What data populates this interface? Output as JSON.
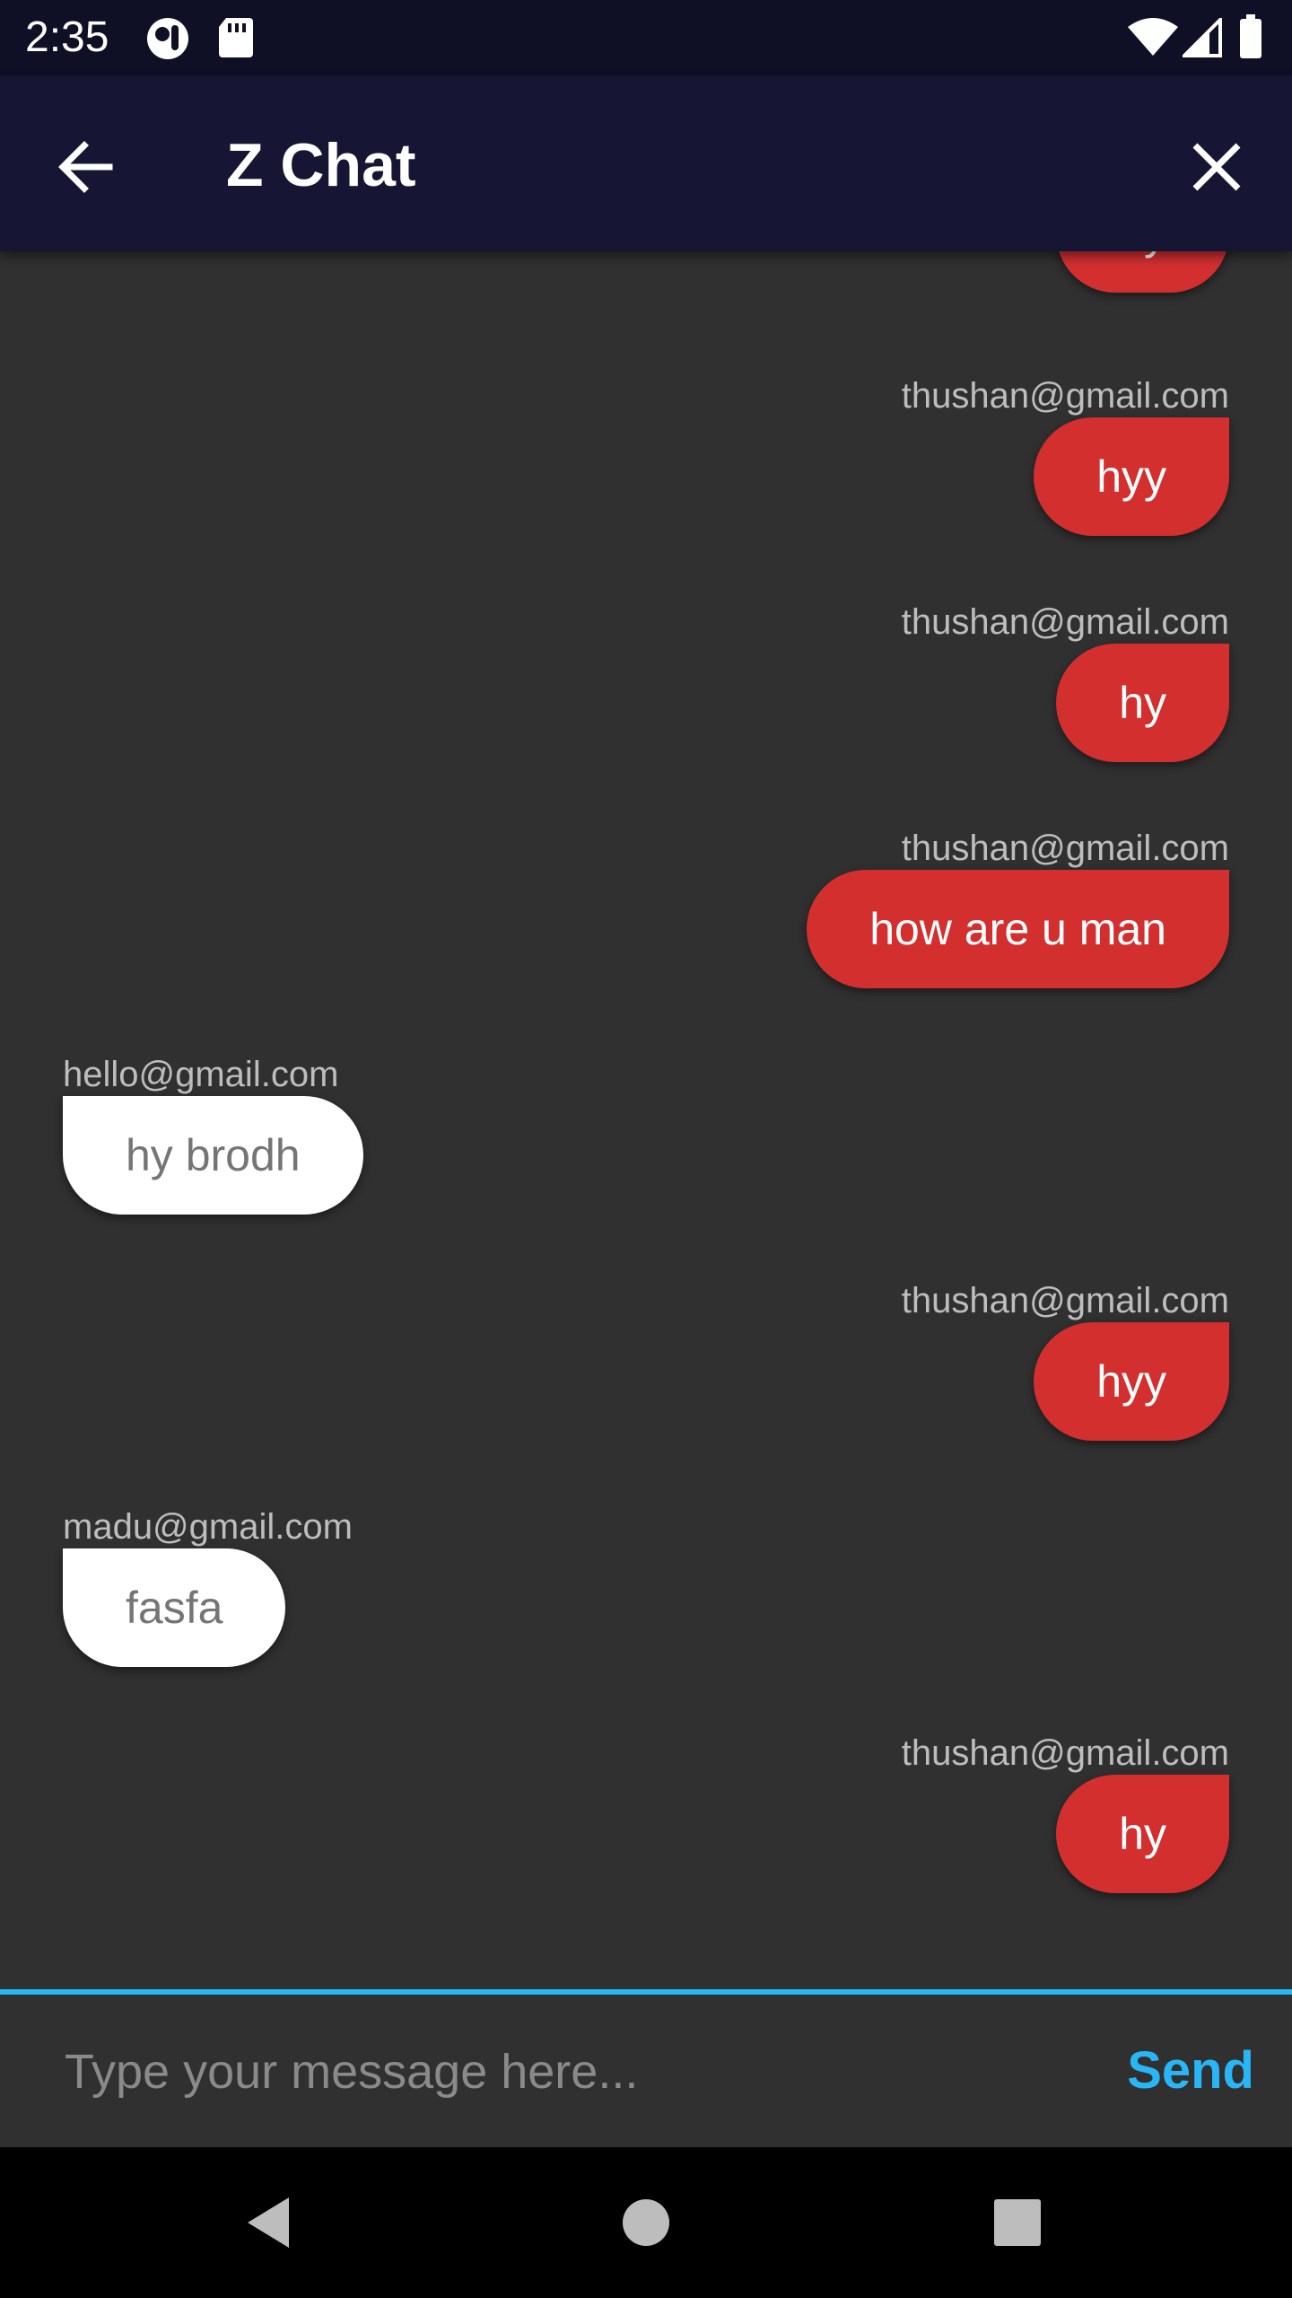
{
  "status_bar": {
    "time": "2:35",
    "icons": [
      "notification-icon",
      "sd-card-icon",
      "wifi-icon",
      "cell-signal-icon",
      "battery-icon"
    ]
  },
  "app_bar": {
    "title": "Z Chat",
    "back_icon": "arrow-back-icon",
    "close_icon": "close-icon"
  },
  "messages": [
    {
      "sender": "",
      "text": "hy",
      "mine": true
    },
    {
      "sender": "thushan@gmail.com",
      "text": "hyy",
      "mine": true
    },
    {
      "sender": "thushan@gmail.com",
      "text": "hy",
      "mine": true
    },
    {
      "sender": "thushan@gmail.com",
      "text": "how are  u man",
      "mine": true
    },
    {
      "sender": "hello@gmail.com",
      "text": "hy brodh",
      "mine": false
    },
    {
      "sender": "thushan@gmail.com",
      "text": "hyy",
      "mine": true
    },
    {
      "sender": "madu@gmail.com",
      "text": "fasfa",
      "mine": false
    },
    {
      "sender": "thushan@gmail.com",
      "text": "hy",
      "mine": true
    }
  ],
  "composer": {
    "placeholder": "Type your message here...",
    "value": "",
    "send_label": "Send"
  },
  "colors": {
    "accent": "#29b6f6",
    "my_bubble": "#d32f2f",
    "other_bubble": "#ffffff",
    "background": "#303030",
    "app_bar": "#161634"
  },
  "nav_bar": {
    "icons": [
      "back-triangle-icon",
      "home-circle-icon",
      "recents-square-icon"
    ]
  }
}
